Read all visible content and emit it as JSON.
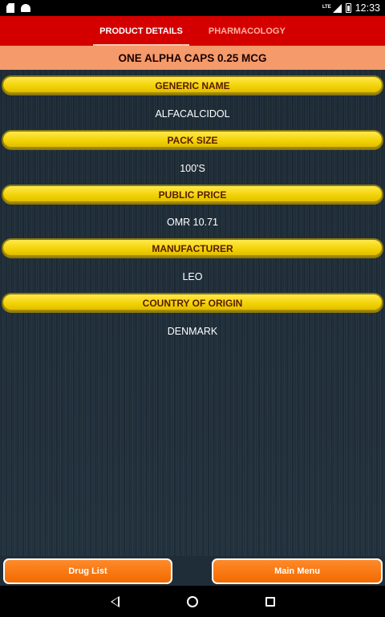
{
  "status_bar": {
    "left_icons": [
      "sd-card-icon",
      "android-icon"
    ],
    "network": "LTE",
    "time": "12:33"
  },
  "tabs": [
    {
      "label": "PRODUCT DETAILS",
      "active": true
    },
    {
      "label": "PHARMACOLOGY",
      "active": false
    }
  ],
  "product_name": "ONE ALPHA CAPS 0.25 MCG",
  "fields": {
    "generic_name": {
      "label": "GENERIC NAME",
      "value": "ALFACALCIDOL"
    },
    "pack_size": {
      "label": "PACK SIZE",
      "value": "100'S"
    },
    "public_price": {
      "label": "PUBLIC PRICE",
      "value": "OMR 10.71"
    },
    "manufacturer": {
      "label": "MANUFACTURER",
      "value": "LEO"
    },
    "country_of_origin": {
      "label": "COUNTRY OF ORIGIN",
      "value": "DENMARK"
    }
  },
  "buttons": {
    "drug_list": "Drug List",
    "main_menu": "Main Menu"
  },
  "nav": [
    "back-icon",
    "home-icon",
    "recents-icon"
  ],
  "colors": {
    "tab_bar": "#d40000",
    "product_banner": "#f59a6b",
    "field_header": "#f0d000",
    "button": "#f26a00",
    "background": "#1f2d38"
  }
}
